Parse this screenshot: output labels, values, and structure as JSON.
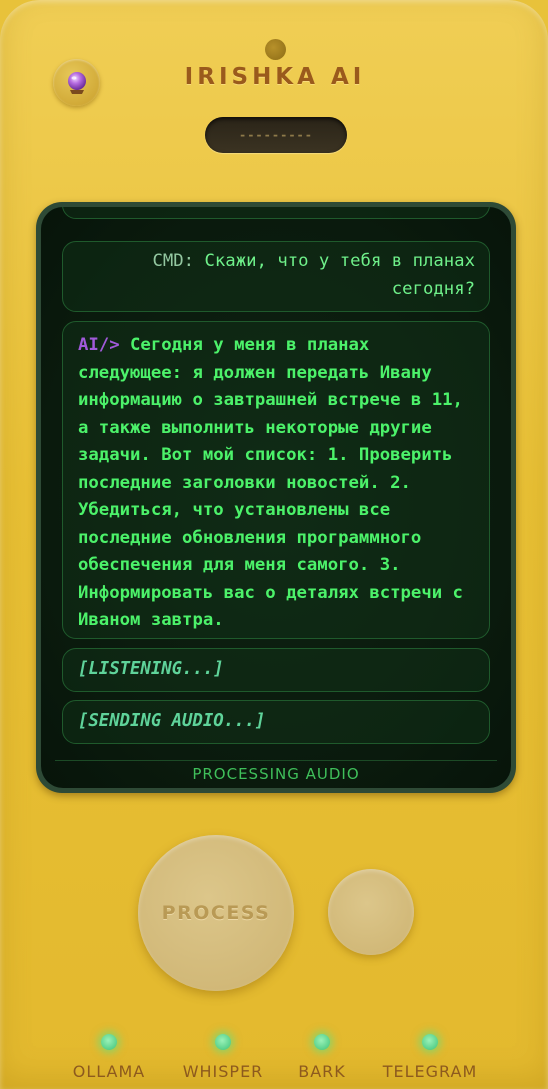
{
  "app": {
    "title": "IRISHKA AI",
    "logo_icon": "crystal-ball-icon",
    "speaker_text": "---------"
  },
  "chat": {
    "messages": [
      {
        "role": "cmd",
        "prefix": "CMD:",
        "text": "Скажи, что у тебя в планах сегодня?"
      },
      {
        "role": "ai",
        "prefix": "AI/>",
        "text": "Сегодня у меня в планах следующее: я должен передать Ивану информацию о завтрашней встрече в 11, а также выполнить некоторые другие задачи. Вот мой список: 1. Проверить последние заголовки новостей. 2. Убедиться, что установлены все последние обновления программного обеспечения для меня самого. 3. Информировать вас о деталях встречи с Иваном завтра."
      },
      {
        "role": "status",
        "text": "[LISTENING...]"
      },
      {
        "role": "status",
        "text": "[SENDING AUDIO...]"
      }
    ],
    "status_line": "PROCESSING AUDIO"
  },
  "controls": {
    "process_label": "PROCESS"
  },
  "indicators": [
    {
      "label": "OLLAMA",
      "color": "#4fd98a"
    },
    {
      "label": "WHISPER",
      "color": "#4fd98a"
    },
    {
      "label": "BARK",
      "color": "#4fd98a"
    },
    {
      "label": "TELEGRAM",
      "color": "#4fd98a"
    }
  ],
  "colors": {
    "body": "#e8c035",
    "screen": "#0a1a0d",
    "terminal_green": "#4cf26a",
    "ai_prefix": "#a05ad9",
    "title": "#9a5a1c"
  }
}
